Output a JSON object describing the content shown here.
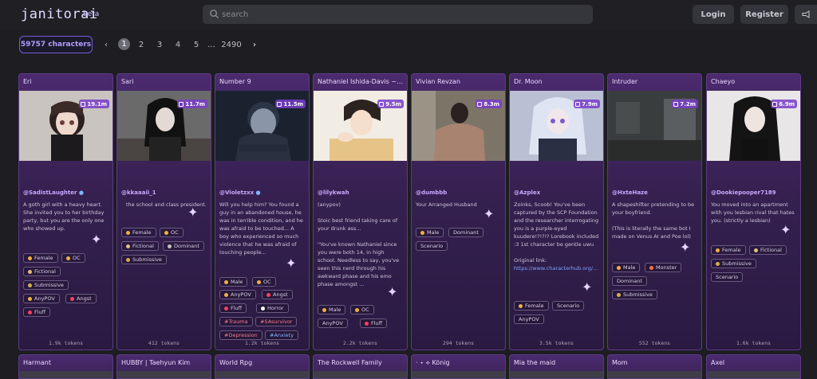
{
  "header": {
    "logo": "janitorai",
    "logo_badge": "beta",
    "search_placeholder": "search",
    "login_label": "Login",
    "register_label": "Register",
    "announce_icon": "megaphone-icon"
  },
  "pagination": {
    "count_label": "59757 characters",
    "pages": [
      "1",
      "2",
      "3",
      "4",
      "5",
      "...",
      "2490"
    ],
    "current": "1"
  },
  "cards": [
    {
      "title": "Eri",
      "count": "19.1m",
      "author": "@SadistLaughter",
      "desc": "A goth girl with a heavy heart. She invited you to her birthday party, but you are the only one who showed up.",
      "tags": [
        "Female",
        "OC",
        "Fictional",
        "Submissive",
        "AnyPOV",
        "Angst",
        "Fluff"
      ],
      "tokens": "1.9k tokens"
    },
    {
      "title": "Sari",
      "count": "11.7m",
      "author": "@kkaaaii_1",
      "desc": "the school and class president.",
      "tags": [
        "Female",
        "OC",
        "Fictional",
        "Dominant",
        "Submissive"
      ],
      "tokens": "412 tokens"
    },
    {
      "title": "Number 9",
      "count": "11.5m",
      "author": "@Violetzxx",
      "desc": "Will you help him? You found a guy in an abandoned house, he was in terrible condition, and he was afraid to be touched... A boy who experienced so much violence that he was afraid of touching people...",
      "tags": [
        "Male",
        "OC",
        "AnyPOV",
        "Angst",
        "Fluff",
        "Horror",
        "#Trauma",
        "#SAsurvivor",
        "#Depression",
        "#Anxiety"
      ],
      "tokens": "1.2k tokens"
    },
    {
      "title": "Nathaniel Ishida-Davis ~ re...",
      "count": "9.5m",
      "author": "@lilykwah",
      "desc": "(anypov)\n\nStoic best friend taking care of your drunk ass...\n\n\"You've known Nathaniel since you were both 14, in high school. Needless to say, you've seen this nerd through his awkward phase and his emo phase amongst ...",
      "tags": [
        "Male",
        "OC",
        "AnyPOV",
        "Fluff"
      ],
      "tokens": "2.2k tokens"
    },
    {
      "title": "Vivian Revzan",
      "count": "8.3m",
      "author": "@dumbbb",
      "desc": "Your Arranged Husband",
      "tags": [
        "Male",
        "Dominant",
        "Scenario"
      ],
      "tokens": "294 tokens"
    },
    {
      "title": "Dr. Moon",
      "count": "7.9m",
      "author": "@Azplex",
      "desc": "Zoinks, Scoob! You've been captured by the SCP Foundation and the researcher interrogating you is a purple-eyed kuudere!?!?!? Lorebook included :3 1st character be gentle uwu\n\nOriginal link:",
      "link": "https://www.characterhub.org/...",
      "tags": [
        "Female",
        "Scenario",
        "AnyPOV"
      ],
      "tokens": "3.5k tokens"
    },
    {
      "title": "Intruder",
      "count": "7.2m",
      "author": "@HxteHaze",
      "desc": "A shapeshifter pretending to be your boyfriend.\n\n(This is literally the same bot I made on Venus AI and Poe lol)",
      "tags": [
        "Male",
        "Monster",
        "Dominant",
        "Submissive"
      ],
      "tokens": "552 tokens"
    },
    {
      "title": "Chaeyo",
      "count": "6.9m",
      "author": "@Dookiepooper7189",
      "desc": "You moved into an apartment with you lesbian rival that hates you. (strictly a lesbian)",
      "tags": [
        "Female",
        "Fictional",
        "Submissive",
        "Scenario"
      ],
      "tokens": "1.6k tokens"
    }
  ],
  "cards_row2": [
    {
      "title": "Harmant"
    },
    {
      "title": "HUBBY | Taehyun Kim"
    },
    {
      "title": "World Rpg"
    },
    {
      "title": "The Rockwell Family"
    },
    {
      "title": "· ⋆ ⟡ König"
    },
    {
      "title": "Mia the maid"
    },
    {
      "title": "Mom"
    },
    {
      "title": "Axel"
    }
  ]
}
